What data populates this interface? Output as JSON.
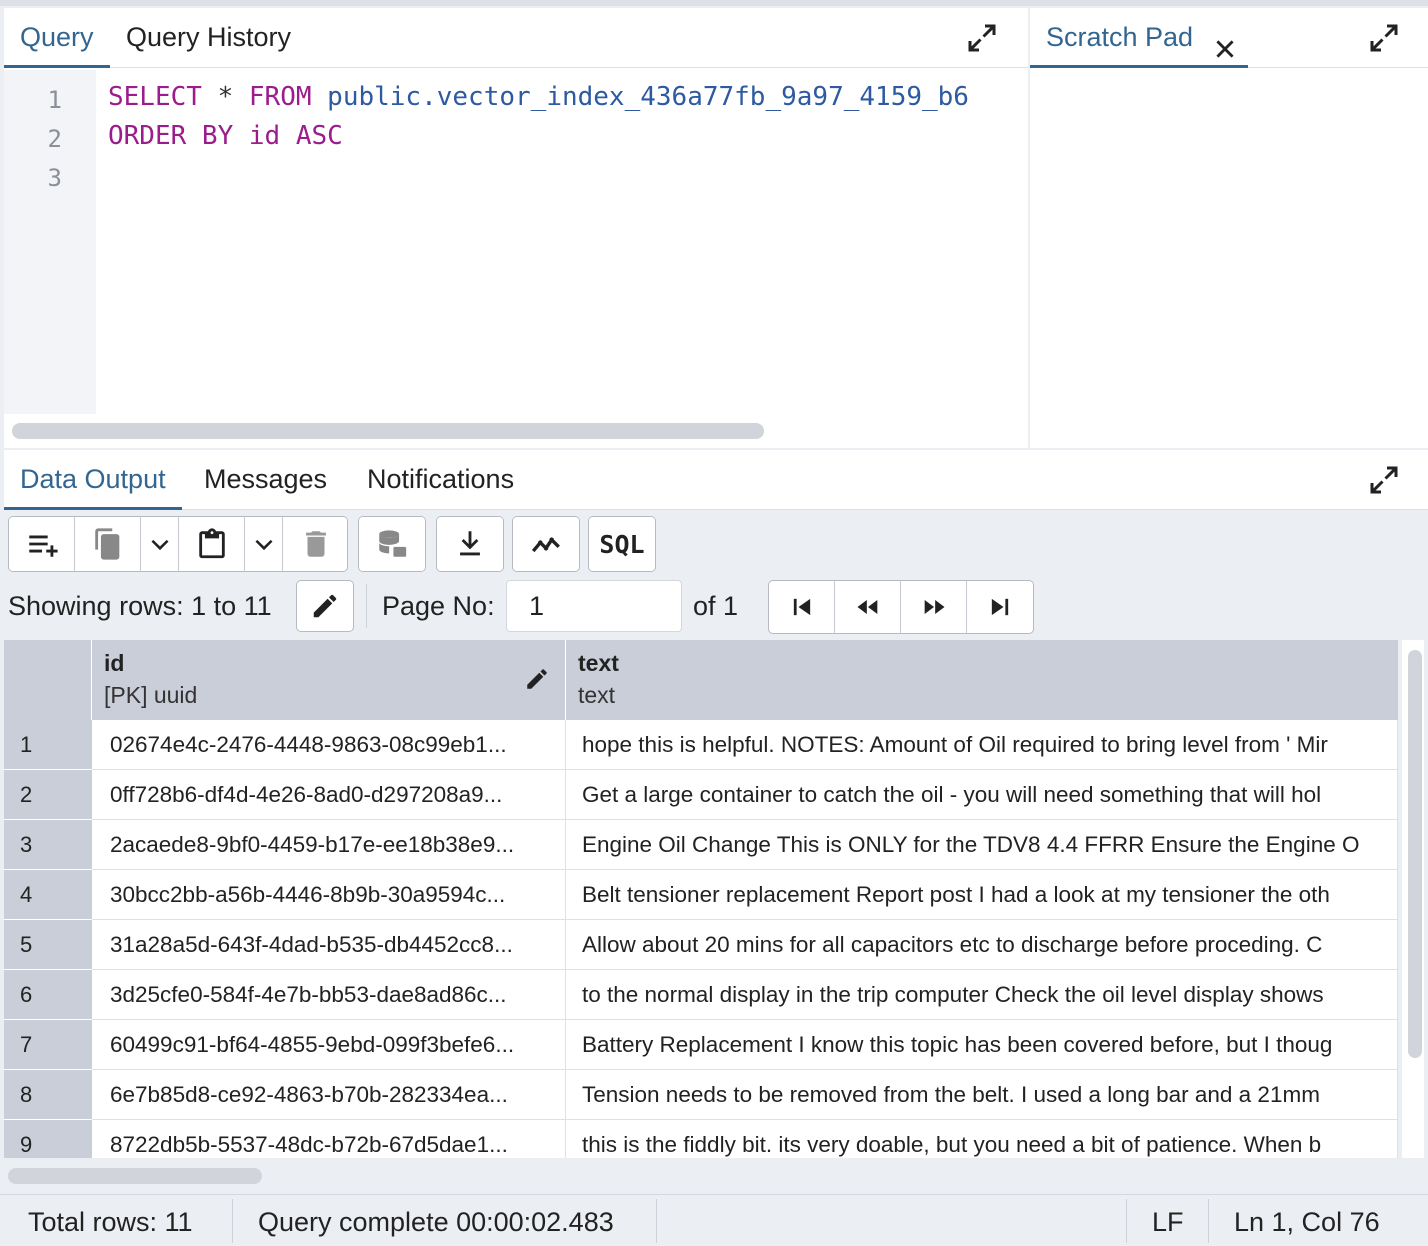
{
  "query_panel": {
    "tabs": [
      {
        "label": "Query",
        "active": true
      },
      {
        "label": "Query History",
        "active": false
      }
    ],
    "line_numbers": [
      "1",
      "2",
      "3"
    ],
    "code": {
      "line1": {
        "kw1": "SELECT",
        "op": " * ",
        "kw2": "FROM",
        "ident": " public.vector_index_436a77fb_9a97_4159_b6"
      },
      "line2": {
        "kw": "ORDER BY id ASC"
      },
      "line3": ""
    }
  },
  "scratch_pad": {
    "tab_label": "Scratch Pad",
    "close_icon": "close-icon"
  },
  "data_panel": {
    "tabs": [
      {
        "label": "Data Output",
        "active": true
      },
      {
        "label": "Messages",
        "active": false
      },
      {
        "label": "Notifications",
        "active": false
      }
    ],
    "toolbar": {
      "icons": [
        "add-row-icon",
        "copy-icon",
        "chevron-down-icon",
        "paste-icon",
        "chevron-down-icon",
        "delete-icon",
        "save-data-icon",
        "download-icon",
        "graph-icon",
        "sql-icon"
      ],
      "sql_label": "SQL"
    },
    "pager": {
      "showing_rows": "Showing rows: 1 to 11",
      "page_no_label": "Page No:",
      "page_no_value": "1",
      "of_label": "of 1"
    },
    "columns": [
      {
        "name": "id",
        "type": "[PK] uuid"
      },
      {
        "name": "text",
        "type": "text"
      }
    ],
    "rows": [
      {
        "num": "1",
        "id": "02674e4c-2476-4448-9863-08c99eb1...",
        "text": "hope this is  helpful. NOTES: Amount of Oil required to bring level from ' Mir"
      },
      {
        "num": "2",
        "id": "0ff728b6-df4d-4e26-8ad0-d297208a9...",
        "text": "Get a large container to  catch the oil - you will need something that will hol"
      },
      {
        "num": "3",
        "id": "2acaede8-9bf0-4459-b17e-ee18b38e9...",
        "text": "Engine Oil Change This is ONLY for the TDV8 4.4 FFRR Ensure the Engine O"
      },
      {
        "num": "4",
        "id": "30bcc2bb-a56b-4446-8b9b-30a9594c...",
        "text": "Belt tensioner replacement Report post I had a look at my tensioner the oth"
      },
      {
        "num": "5",
        "id": "31a28a5d-643f-4dad-b535-db4452cc8...",
        "text": "Allow about 20 mins for all capacitors etc to discharge before  proceding. C"
      },
      {
        "num": "6",
        "id": "3d25cfe0-584f-4e7b-bb53-dae8ad86c...",
        "text": "to the  normal display in the trip computer Check the oil level display shows"
      },
      {
        "num": "7",
        "id": "60499c91-bf64-4855-9ebd-099f3befe6...",
        "text": "Battery Replacement I know this topic has been covered before, but I thoug"
      },
      {
        "num": "8",
        "id": "6e7b85d8-ce92-4863-b70b-282334ea...",
        "text": "Tension  needs to be removed from the belt. I used a long bar and a 21mm"
      },
      {
        "num": "9",
        "id": "8722db5b-5537-48dc-b72b-67d5dae1...",
        "text": "this is the fiddly bit. its very doable, but you need a bit of  patience. When b"
      }
    ]
  },
  "statusbar": {
    "total_rows": "Total rows: 11",
    "query_status": "Query complete 00:00:02.483",
    "line_ending": "LF",
    "cursor": "Ln 1, Col 76"
  },
  "colors": {
    "accent": "#326690",
    "keyword": "#9b1d8c",
    "identifier": "#2d5aa0",
    "header_bg": "#c9ced8"
  }
}
